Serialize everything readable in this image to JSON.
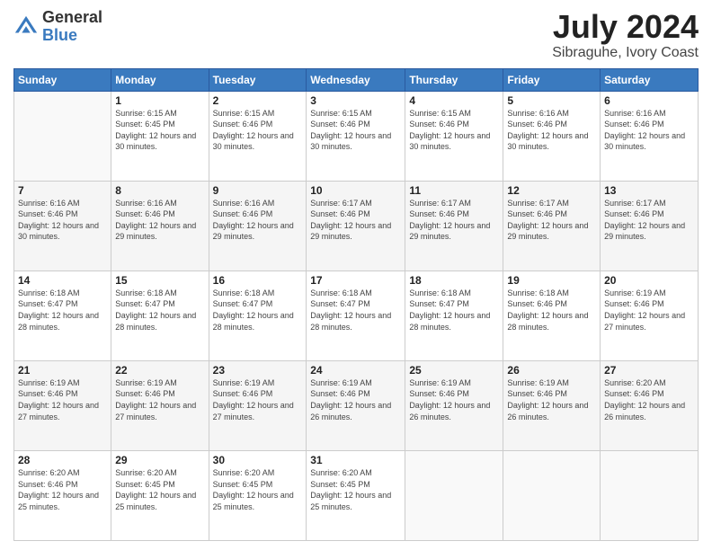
{
  "logo": {
    "general": "General",
    "blue": "Blue"
  },
  "title": "July 2024",
  "subtitle": "Sibraguhe, Ivory Coast",
  "weekdays": [
    "Sunday",
    "Monday",
    "Tuesday",
    "Wednesday",
    "Thursday",
    "Friday",
    "Saturday"
  ],
  "weeks": [
    [
      {
        "day": "",
        "sunrise": "",
        "sunset": "",
        "daylight": ""
      },
      {
        "day": "1",
        "sunrise": "Sunrise: 6:15 AM",
        "sunset": "Sunset: 6:45 PM",
        "daylight": "Daylight: 12 hours and 30 minutes."
      },
      {
        "day": "2",
        "sunrise": "Sunrise: 6:15 AM",
        "sunset": "Sunset: 6:46 PM",
        "daylight": "Daylight: 12 hours and 30 minutes."
      },
      {
        "day": "3",
        "sunrise": "Sunrise: 6:15 AM",
        "sunset": "Sunset: 6:46 PM",
        "daylight": "Daylight: 12 hours and 30 minutes."
      },
      {
        "day": "4",
        "sunrise": "Sunrise: 6:15 AM",
        "sunset": "Sunset: 6:46 PM",
        "daylight": "Daylight: 12 hours and 30 minutes."
      },
      {
        "day": "5",
        "sunrise": "Sunrise: 6:16 AM",
        "sunset": "Sunset: 6:46 PM",
        "daylight": "Daylight: 12 hours and 30 minutes."
      },
      {
        "day": "6",
        "sunrise": "Sunrise: 6:16 AM",
        "sunset": "Sunset: 6:46 PM",
        "daylight": "Daylight: 12 hours and 30 minutes."
      }
    ],
    [
      {
        "day": "7",
        "sunrise": "Sunrise: 6:16 AM",
        "sunset": "Sunset: 6:46 PM",
        "daylight": "Daylight: 12 hours and 30 minutes."
      },
      {
        "day": "8",
        "sunrise": "Sunrise: 6:16 AM",
        "sunset": "Sunset: 6:46 PM",
        "daylight": "Daylight: 12 hours and 29 minutes."
      },
      {
        "day": "9",
        "sunrise": "Sunrise: 6:16 AM",
        "sunset": "Sunset: 6:46 PM",
        "daylight": "Daylight: 12 hours and 29 minutes."
      },
      {
        "day": "10",
        "sunrise": "Sunrise: 6:17 AM",
        "sunset": "Sunset: 6:46 PM",
        "daylight": "Daylight: 12 hours and 29 minutes."
      },
      {
        "day": "11",
        "sunrise": "Sunrise: 6:17 AM",
        "sunset": "Sunset: 6:46 PM",
        "daylight": "Daylight: 12 hours and 29 minutes."
      },
      {
        "day": "12",
        "sunrise": "Sunrise: 6:17 AM",
        "sunset": "Sunset: 6:46 PM",
        "daylight": "Daylight: 12 hours and 29 minutes."
      },
      {
        "day": "13",
        "sunrise": "Sunrise: 6:17 AM",
        "sunset": "Sunset: 6:46 PM",
        "daylight": "Daylight: 12 hours and 29 minutes."
      }
    ],
    [
      {
        "day": "14",
        "sunrise": "Sunrise: 6:18 AM",
        "sunset": "Sunset: 6:47 PM",
        "daylight": "Daylight: 12 hours and 28 minutes."
      },
      {
        "day": "15",
        "sunrise": "Sunrise: 6:18 AM",
        "sunset": "Sunset: 6:47 PM",
        "daylight": "Daylight: 12 hours and 28 minutes."
      },
      {
        "day": "16",
        "sunrise": "Sunrise: 6:18 AM",
        "sunset": "Sunset: 6:47 PM",
        "daylight": "Daylight: 12 hours and 28 minutes."
      },
      {
        "day": "17",
        "sunrise": "Sunrise: 6:18 AM",
        "sunset": "Sunset: 6:47 PM",
        "daylight": "Daylight: 12 hours and 28 minutes."
      },
      {
        "day": "18",
        "sunrise": "Sunrise: 6:18 AM",
        "sunset": "Sunset: 6:47 PM",
        "daylight": "Daylight: 12 hours and 28 minutes."
      },
      {
        "day": "19",
        "sunrise": "Sunrise: 6:18 AM",
        "sunset": "Sunset: 6:46 PM",
        "daylight": "Daylight: 12 hours and 28 minutes."
      },
      {
        "day": "20",
        "sunrise": "Sunrise: 6:19 AM",
        "sunset": "Sunset: 6:46 PM",
        "daylight": "Daylight: 12 hours and 27 minutes."
      }
    ],
    [
      {
        "day": "21",
        "sunrise": "Sunrise: 6:19 AM",
        "sunset": "Sunset: 6:46 PM",
        "daylight": "Daylight: 12 hours and 27 minutes."
      },
      {
        "day": "22",
        "sunrise": "Sunrise: 6:19 AM",
        "sunset": "Sunset: 6:46 PM",
        "daylight": "Daylight: 12 hours and 27 minutes."
      },
      {
        "day": "23",
        "sunrise": "Sunrise: 6:19 AM",
        "sunset": "Sunset: 6:46 PM",
        "daylight": "Daylight: 12 hours and 27 minutes."
      },
      {
        "day": "24",
        "sunrise": "Sunrise: 6:19 AM",
        "sunset": "Sunset: 6:46 PM",
        "daylight": "Daylight: 12 hours and 26 minutes."
      },
      {
        "day": "25",
        "sunrise": "Sunrise: 6:19 AM",
        "sunset": "Sunset: 6:46 PM",
        "daylight": "Daylight: 12 hours and 26 minutes."
      },
      {
        "day": "26",
        "sunrise": "Sunrise: 6:19 AM",
        "sunset": "Sunset: 6:46 PM",
        "daylight": "Daylight: 12 hours and 26 minutes."
      },
      {
        "day": "27",
        "sunrise": "Sunrise: 6:20 AM",
        "sunset": "Sunset: 6:46 PM",
        "daylight": "Daylight: 12 hours and 26 minutes."
      }
    ],
    [
      {
        "day": "28",
        "sunrise": "Sunrise: 6:20 AM",
        "sunset": "Sunset: 6:46 PM",
        "daylight": "Daylight: 12 hours and 25 minutes."
      },
      {
        "day": "29",
        "sunrise": "Sunrise: 6:20 AM",
        "sunset": "Sunset: 6:45 PM",
        "daylight": "Daylight: 12 hours and 25 minutes."
      },
      {
        "day": "30",
        "sunrise": "Sunrise: 6:20 AM",
        "sunset": "Sunset: 6:45 PM",
        "daylight": "Daylight: 12 hours and 25 minutes."
      },
      {
        "day": "31",
        "sunrise": "Sunrise: 6:20 AM",
        "sunset": "Sunset: 6:45 PM",
        "daylight": "Daylight: 12 hours and 25 minutes."
      },
      {
        "day": "",
        "sunrise": "",
        "sunset": "",
        "daylight": ""
      },
      {
        "day": "",
        "sunrise": "",
        "sunset": "",
        "daylight": ""
      },
      {
        "day": "",
        "sunrise": "",
        "sunset": "",
        "daylight": ""
      }
    ]
  ]
}
